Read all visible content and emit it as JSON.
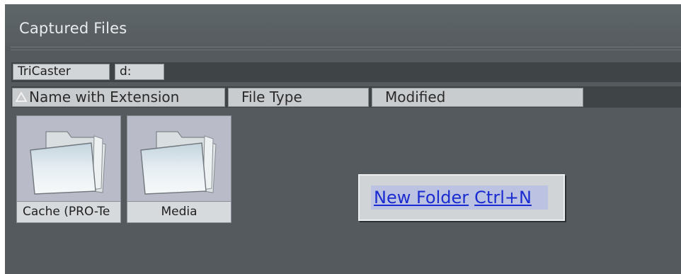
{
  "window": {
    "title": "Captured Files"
  },
  "path_bar": {
    "segments": [
      "TriCaster",
      "d:"
    ]
  },
  "columns": [
    {
      "label": "Name with Extension",
      "sorted": "ascending"
    },
    {
      "label": "File Type"
    },
    {
      "label": "Modified"
    }
  ],
  "files": [
    {
      "label": "Cache (PRO-Te",
      "icon": "folder-icon"
    },
    {
      "label": "Media",
      "icon": "folder-icon"
    }
  ],
  "context_menu": {
    "items": [
      {
        "label": "New Folder",
        "shortcut": "Ctrl+N"
      }
    ]
  },
  "colors": {
    "panel_bg": "#545a5d",
    "menu_text": "#1a2bd0",
    "menu_highlight": "#bcc3e2"
  }
}
